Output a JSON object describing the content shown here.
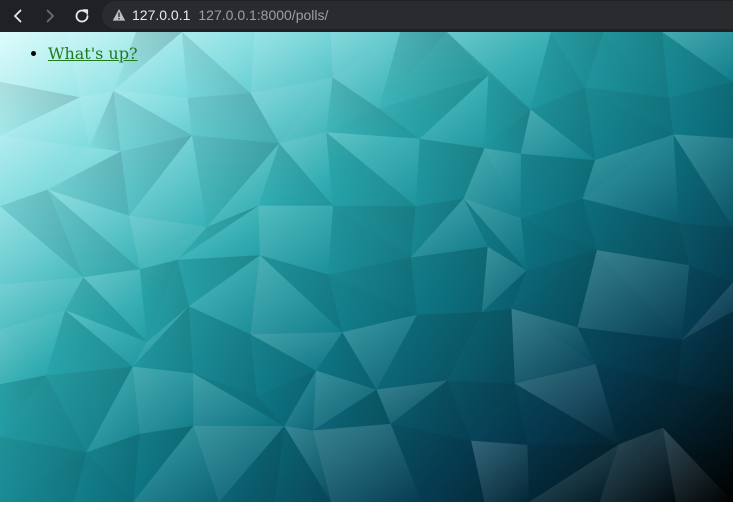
{
  "browser": {
    "back_icon": "chevron-left-icon",
    "forward_icon": "chevron-right-icon",
    "reload_icon": "reload-icon",
    "security_icon": "warning-triangle-icon",
    "host": "127.0.0.1",
    "url": "127.0.0.1:8000/polls/"
  },
  "page": {
    "poll_links": [
      {
        "label": "What's up?"
      }
    ],
    "link_color": "#1f7a1f",
    "background_colors": [
      "#d6fbfb",
      "#6fd3d6",
      "#1fa2a8",
      "#0b6d7a",
      "#053a4f",
      "#000000"
    ]
  }
}
